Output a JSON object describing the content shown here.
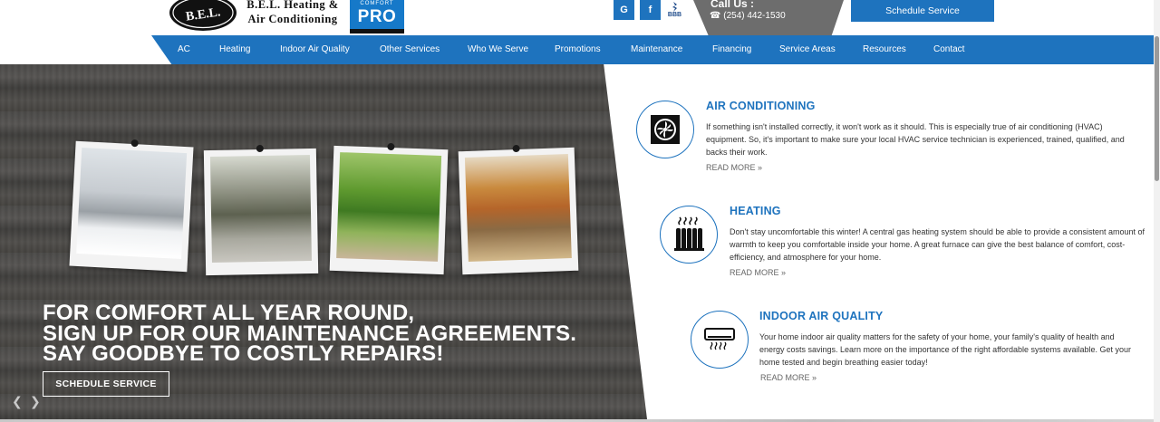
{
  "header": {
    "logo_bel_badge": "B.E.L.",
    "logo_bel_name": "B.E.L. Heating & Air Conditioning",
    "logo_pro_top": "COMFORT",
    "logo_pro_word": "PRO",
    "social": [
      {
        "icon": "google-icon",
        "glyph": "G"
      },
      {
        "icon": "facebook-icon",
        "glyph": "f"
      },
      {
        "icon": "bbb-icon",
        "glyph": "BBB"
      }
    ],
    "call_title": "Call Us :",
    "call_phone": "(254) 442-1530",
    "schedule_label": "Schedule Service"
  },
  "nav": {
    "items": [
      {
        "label": "AC"
      },
      {
        "label": "Heating"
      },
      {
        "label": "Indoor Air Quality"
      },
      {
        "label": "Other Services"
      },
      {
        "label": "Who We Serve"
      },
      {
        "label": "Promotions"
      },
      {
        "label": "Maintenance"
      },
      {
        "label": "Financing"
      },
      {
        "label": "Service Areas"
      },
      {
        "label": "Resources"
      },
      {
        "label": "Contact"
      }
    ]
  },
  "hero": {
    "headline_1": "FOR COMFORT ALL YEAR ROUND,",
    "headline_2": "SIGN UP FOR OUR MAINTENANCE AGREEMENTS.",
    "headline_3": "SAY GOODBYE TO COSTLY REPAIRS!",
    "button_label": "SCHEDULE SERVICE",
    "prev_glyph": "❮",
    "next_glyph": "❯"
  },
  "services": [
    {
      "icon": "fan-unit-icon",
      "title": "AIR CONDITIONING",
      "description": "If something isn't installed correctly, it won't work as it should. This is especially true of air conditioning (HVAC) equipment. So, it's important to make sure your local HVAC service technician is experienced, trained, qualified, and backs their work.",
      "more": "READ MORE »"
    },
    {
      "icon": "radiator-icon",
      "title": "HEATING",
      "description": "Don't stay uncomfortable this winter! A central gas heating system should be able to provide a consistent amount of warmth to keep you comfortable inside your home. A great furnace can give the best balance of comfort, cost-efficiency, and atmosphere for your home.",
      "more": "READ MORE »"
    },
    {
      "icon": "wall-unit-icon",
      "title": "INDOOR AIR QUALITY",
      "description": "Your home indoor air quality matters for the safety of your home, your family's quality of health and energy costs savings. Learn more on the importance of the right affordable systems available. Get your home tested and begin breathing easier today!",
      "more": "READ MORE »"
    }
  ],
  "colors": {
    "brand_blue": "#1e73be",
    "call_gray": "#6d6d6d"
  }
}
